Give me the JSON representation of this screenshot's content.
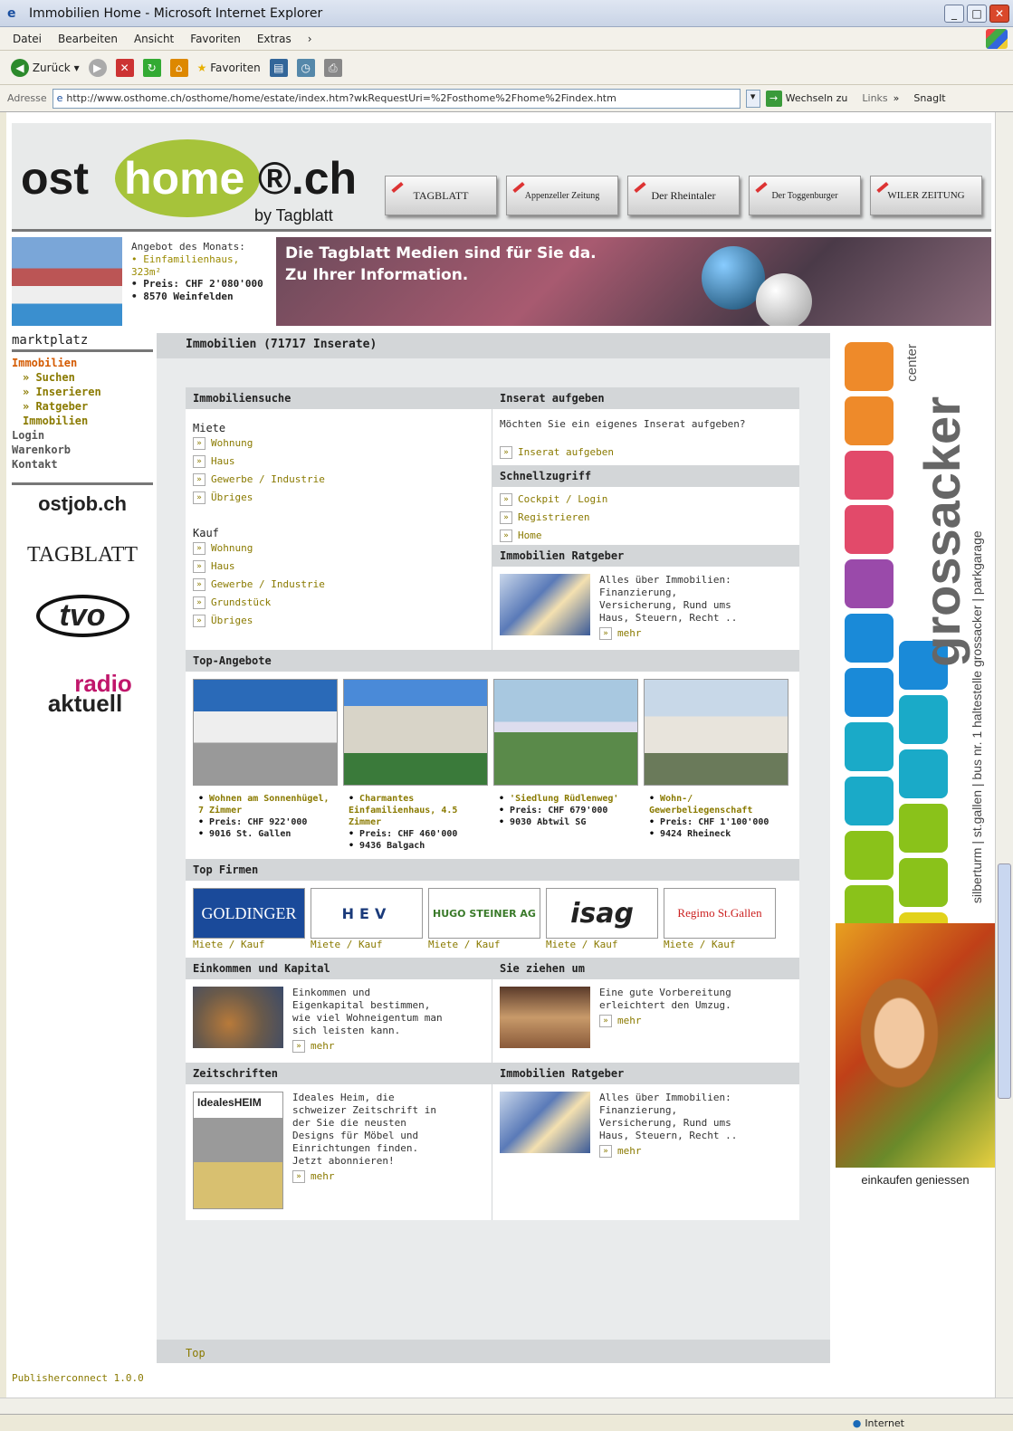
{
  "window": {
    "title": "Immobilien Home - Microsoft Internet Explorer"
  },
  "menu": [
    "Datei",
    "Bearbeiten",
    "Ansicht",
    "Favoriten",
    "Extras"
  ],
  "toolbar": {
    "back": "Zurück",
    "favorites": "Favoriten"
  },
  "address": {
    "label": "Adresse",
    "url": "http://www.osthome.ch/osthome/home/estate/index.htm?wkRequestUri=%2Fosthome%2Fhome%2Findex.htm",
    "go": "Wechseln zu",
    "links": "Links",
    "snagit": "SnagIt"
  },
  "header": {
    "logo_ost": "ost",
    "logo_home": "home",
    "logo_ch": "®.ch",
    "logo_by": "by Tagblatt",
    "papers": [
      "TAGBLATT",
      "Appenzeller Zeitung",
      "Der Rheintaler",
      "Der Toggenburger",
      "WILER ZEITUNG"
    ]
  },
  "banner": {
    "offer_title": "Angebot des Monats:",
    "offer_item1": "Einfamilienhaus, 323m²",
    "offer_price": "Preis: CHF 2'080'000",
    "offer_place": "8570 Weinfelden",
    "line1": "Die Tagblatt Medien sind für Sie da.",
    "line2": "Zu Ihrer Information."
  },
  "nav": {
    "title": "marktplatz",
    "items": [
      {
        "label": "Immobilien",
        "kind": "act"
      },
      {
        "label": "» Suchen",
        "kind": "sub"
      },
      {
        "label": "» Inserieren",
        "kind": "sub"
      },
      {
        "label": "» Ratgeber Immobilien",
        "kind": "sub"
      },
      {
        "label": "Login",
        "kind": ""
      },
      {
        "label": "Warenkorb",
        "kind": ""
      },
      {
        "label": "Kontakt",
        "kind": ""
      }
    ]
  },
  "partners": {
    "ostjob": "ostjob.ch",
    "tagblatt": "TAGBLATT",
    "tvo": "tvo",
    "radio1": "radio",
    "radio2": "aktuell"
  },
  "main": {
    "title": "Immobilien (71717 Inserate)",
    "search": {
      "title": "Immobiliensuche",
      "miete": "Miete",
      "miete_items": [
        "Wohnung",
        "Haus",
        "Gewerbe / Industrie",
        "Übriges"
      ],
      "kauf": "Kauf",
      "kauf_items": [
        "Wohnung",
        "Haus",
        "Gewerbe / Industrie",
        "Grundstück",
        "Übriges"
      ]
    },
    "inserat": {
      "title": "Inserat aufgeben",
      "text": "Möchten Sie ein eigenes Inserat aufgeben?",
      "link": "Inserat aufgeben"
    },
    "schnell": {
      "title": "Schnellzugriff",
      "items": [
        "Cockpit / Login",
        "Registrieren",
        "Home"
      ]
    },
    "ratgeber": {
      "title": "Immobilien Ratgeber",
      "text": "Alles über Immobilien: Finanzierung, Versicherung, Rund ums Haus, Steuern, Recht ..",
      "more": "mehr"
    },
    "top_title": "Top-Angebote",
    "tops": [
      {
        "l1": "Wohnen am Sonnenhügel, 7 Zimmer",
        "l2": "Preis: CHF 922'000",
        "l3": "9016 St. Gallen"
      },
      {
        "l1": "Charmantes Einfamilienhaus, 4.5 Zimmer",
        "l2": "Preis: CHF 460'000",
        "l3": "9436 Balgach"
      },
      {
        "l1": "'Siedlung Rüdlenweg'",
        "l2": "Preis: CHF 679'000",
        "l3": "9030 Abtwil SG"
      },
      {
        "l1": "Wohn-/ Gewerbeliegenschaft",
        "l2": "Preis: CHF 1'100'000",
        "l3": "9424 Rheineck"
      }
    ],
    "firms_title": "Top Firmen",
    "firms": [
      {
        "name": "GOLDINGER",
        "link": "Miete / Kauf"
      },
      {
        "name": "HEV",
        "link": "Miete / Kauf"
      },
      {
        "name": "HUGO STEINER AG",
        "link": "Miete / Kauf"
      },
      {
        "name": "isag",
        "link": "Miete / Kauf"
      },
      {
        "name": "Regimo St.Gallen",
        "link": "Miete / Kauf"
      }
    ],
    "eink": {
      "title": "Einkommen und Kapital",
      "text": "Einkommen und Eigenkapital bestimmen, wie viel Wohneigentum man sich leisten kann.",
      "more": "mehr"
    },
    "umzug": {
      "title": "Sie ziehen um",
      "text": "Eine gute Vorbereitung erleichtert den Umzug.",
      "more": "mehr"
    },
    "zeit": {
      "title": "Zeitschriften",
      "mag": "IdealesHEIM",
      "text": "Ideales Heim, die schweizer Zeitschrift in der Sie die neusten Designs für Möbel und Einrichtungen finden. Jetzt abonnieren!",
      "more": "mehr"
    },
    "ratgeber2": {
      "title": "Immobilien Ratgeber",
      "text": "Alles über Immobilien: Finanzierung, Versicherung, Rund ums Haus, Steuern, Recht ..",
      "more": "mehr"
    },
    "top_link": "Top"
  },
  "ad": {
    "center": "center",
    "name": "grossacker",
    "right": "silberturm | st.gallen | bus nr. 1 haltestelle grossacker | parkgarage",
    "slogan": "einkaufen geniessen"
  },
  "footer": {
    "pub": "Publisherconnect 1.0.0"
  },
  "status": {
    "zone": "Internet"
  }
}
